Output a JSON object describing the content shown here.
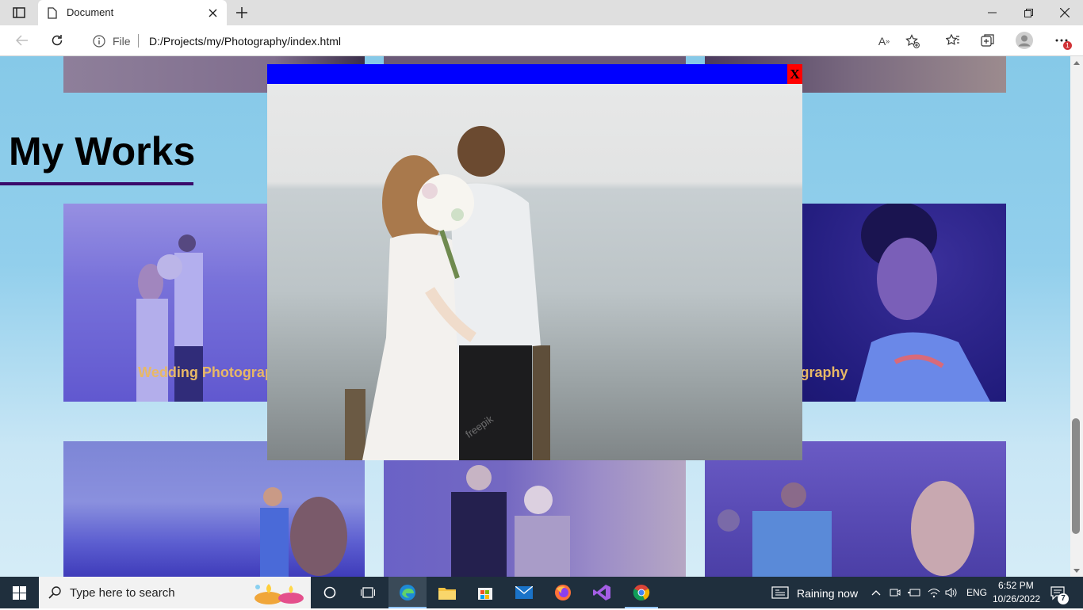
{
  "browser": {
    "tab_title": "Document",
    "address_prefix": "File",
    "url": "D:/Projects/my/Photography/index.html",
    "notification_badge": "1"
  },
  "page": {
    "section_title": "My Works",
    "cards": [
      {
        "caption": "Wedding Photography"
      },
      {
        "caption": "hotography"
      }
    ]
  },
  "modal": {
    "close_label": "X",
    "watermark": "freepik"
  },
  "taskbar": {
    "search_placeholder": "Type here to search",
    "weather": "Raining now",
    "language": "ENG",
    "time": "6:52 PM",
    "date": "10/26/2022",
    "notification_count": "7"
  },
  "colors": {
    "accent_underline": "#3a0a6a",
    "caption": "#e8b866",
    "modal_bar": "#0000ff",
    "close_button": "#ff0000"
  }
}
